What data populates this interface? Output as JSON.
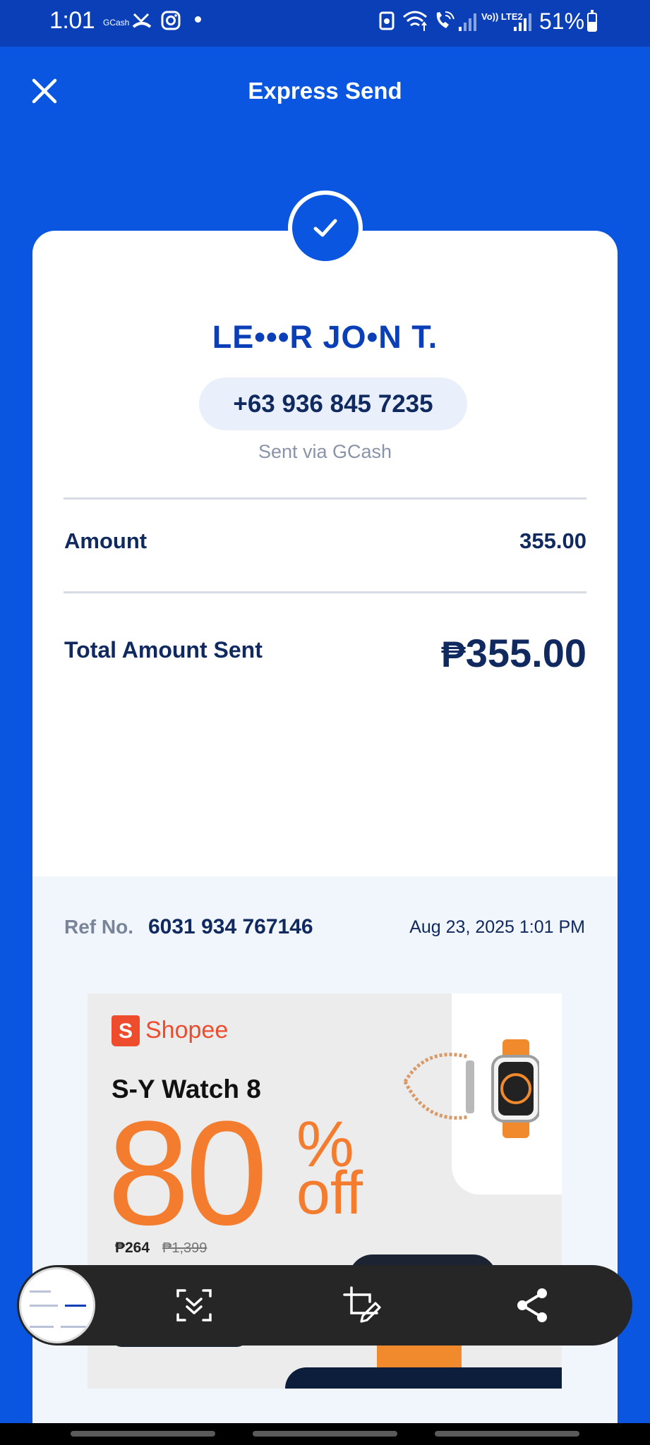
{
  "status_bar": {
    "time": "1:01",
    "notif_app": "GCash",
    "network_lte": "Vo)) LTE2",
    "battery": "51%",
    "battery_level": 0.51
  },
  "header": {
    "title": "Express Send",
    "close_icon": "close-icon"
  },
  "receipt": {
    "status_icon": "check-icon",
    "recipient_name": "LE•••R JO•N T.",
    "phone": "+63 936 845 7235",
    "sent_via": "Sent via GCash",
    "amount_label": "Amount",
    "amount_value": "355.00",
    "total_label": "Total Amount Sent",
    "total_currency": "₱",
    "total_value": "355.00"
  },
  "footer": {
    "ref_label": "Ref No.",
    "ref_number": "6031 934 767146",
    "date": "Aug 23, 2025 1:01 PM"
  },
  "ad": {
    "brand": "Shopee",
    "brand_logo_letter": "S",
    "product": "S-Y Watch 8",
    "discount_number": "80",
    "discount_percent": "%",
    "discount_off": "off",
    "price": "₱264",
    "old_price": "₱1,399"
  },
  "screenshot_toolbar": {
    "buttons": [
      "scroll-capture-icon",
      "crop-edit-icon",
      "share-icon"
    ]
  },
  "colors": {
    "primary": "#0a56e0",
    "status_bar": "#0a3fb8",
    "text_dark": "#102a60",
    "shopee": "#ee4d2d",
    "ad_orange": "#f47c2f"
  }
}
